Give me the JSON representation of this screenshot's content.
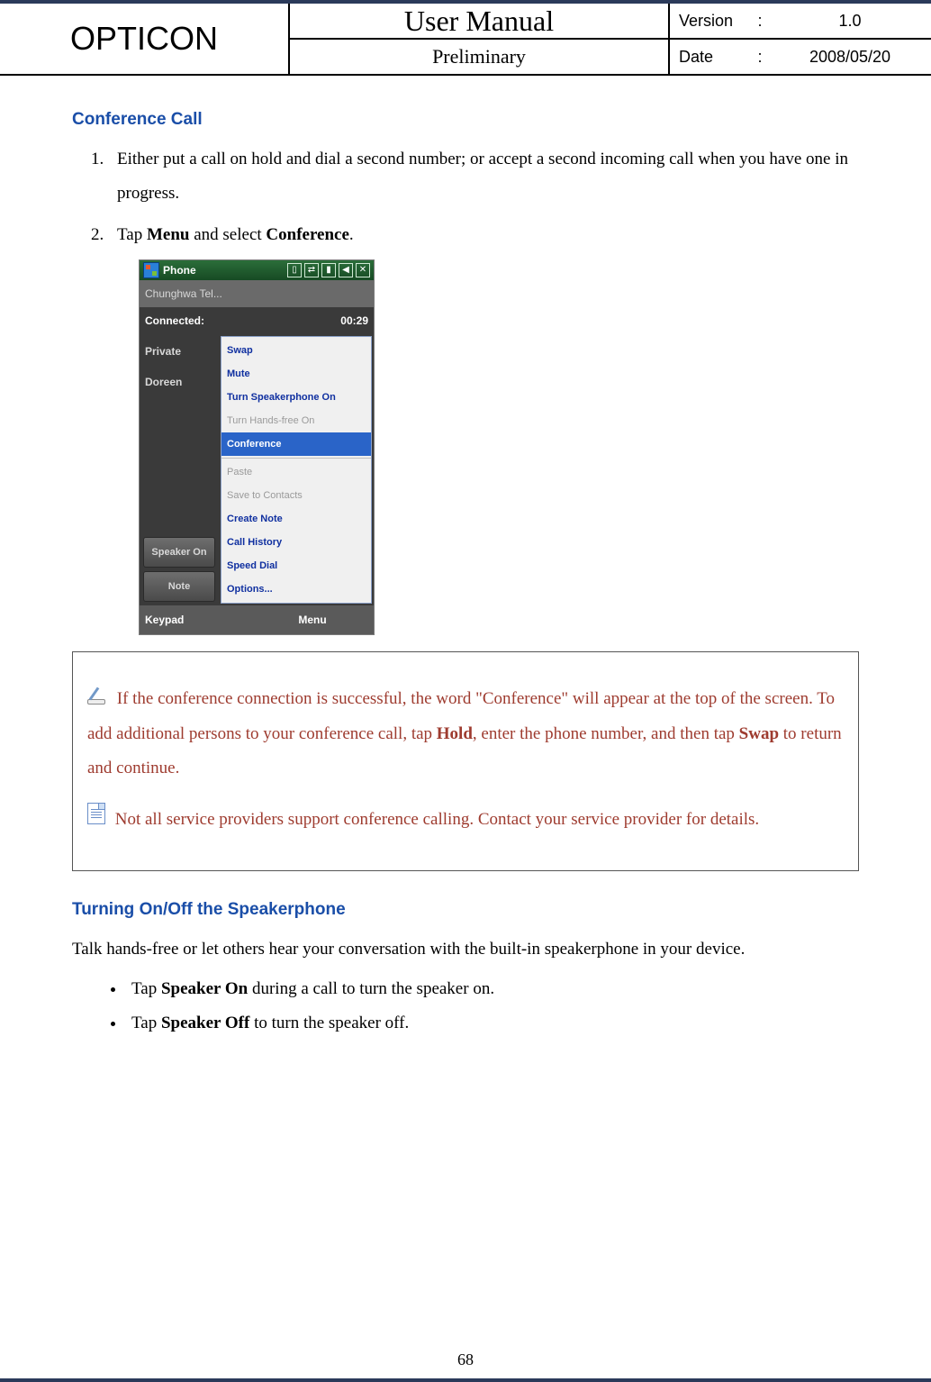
{
  "header": {
    "brand": "OPTICON",
    "title": "User Manual",
    "subtitle": "Preliminary",
    "version_label": "Version",
    "version_value": "1.0",
    "date_label": "Date",
    "date_value": "2008/05/20"
  },
  "section1": {
    "heading": "Conference Call",
    "step1": "Either put a call on hold and dial a second number; or accept a second incoming call when you have one in progress.",
    "step2_pre": "Tap ",
    "step2_menu": "Menu",
    "step2_mid": " and select ",
    "step2_conf": "Conference",
    "step2_post": "."
  },
  "screenshot": {
    "title": "Phone",
    "carrier": "Chunghwa Tel...",
    "connected_label": "Connected:",
    "connected_time": "00:29",
    "label_private": "Private",
    "label_doreen": "Doreen",
    "btn_speaker": "Speaker On",
    "btn_note": "Note",
    "menu_items": {
      "swap": "Swap",
      "mute": "Mute",
      "spkr": "Turn Speakerphone On",
      "hands": "Turn Hands-free On",
      "conf": "Conference",
      "paste": "Paste",
      "save": "Save to Contacts",
      "cnote": "Create Note",
      "hist": "Call History",
      "speed": "Speed Dial",
      "opt": "Options..."
    },
    "foot_left": "Keypad",
    "foot_right": "Menu"
  },
  "note": {
    "tip_a": " If the conference connection is successful, the word \"Conference\" will appear at the top of the screen. To add additional persons to your conference call, tap ",
    "tip_hold": "Hold",
    "tip_b": ", enter the phone number, and then tap ",
    "tip_swap": "Swap",
    "tip_c": " to return and continue.",
    "info": " Not all service providers support conference calling. Contact your service provider for details."
  },
  "section2": {
    "heading": "Turning On/Off the Speakerphone",
    "intro": "Talk hands-free or let others hear your conversation with the built-in speakerphone in your device.",
    "b1_pre": "Tap ",
    "b1_b": "Speaker On",
    "b1_post": " during a call to turn the speaker on.",
    "b2_pre": "Tap ",
    "b2_b": "Speaker Off",
    "b2_post": " to turn the speaker off."
  },
  "page_number": "68"
}
